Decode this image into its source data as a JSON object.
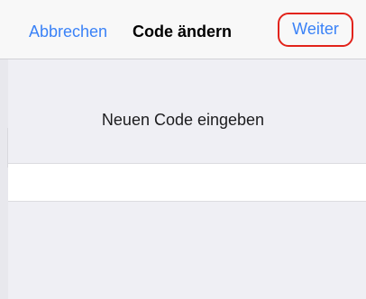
{
  "navbar": {
    "cancel_label": "Abbrechen",
    "title": "Code ändern",
    "next_label": "Weiter"
  },
  "main": {
    "prompt": "Neuen Code eingeben",
    "code_value": ""
  },
  "colors": {
    "accent": "#3a82f7",
    "highlight": "#e2231a",
    "background": "#efeff4"
  }
}
